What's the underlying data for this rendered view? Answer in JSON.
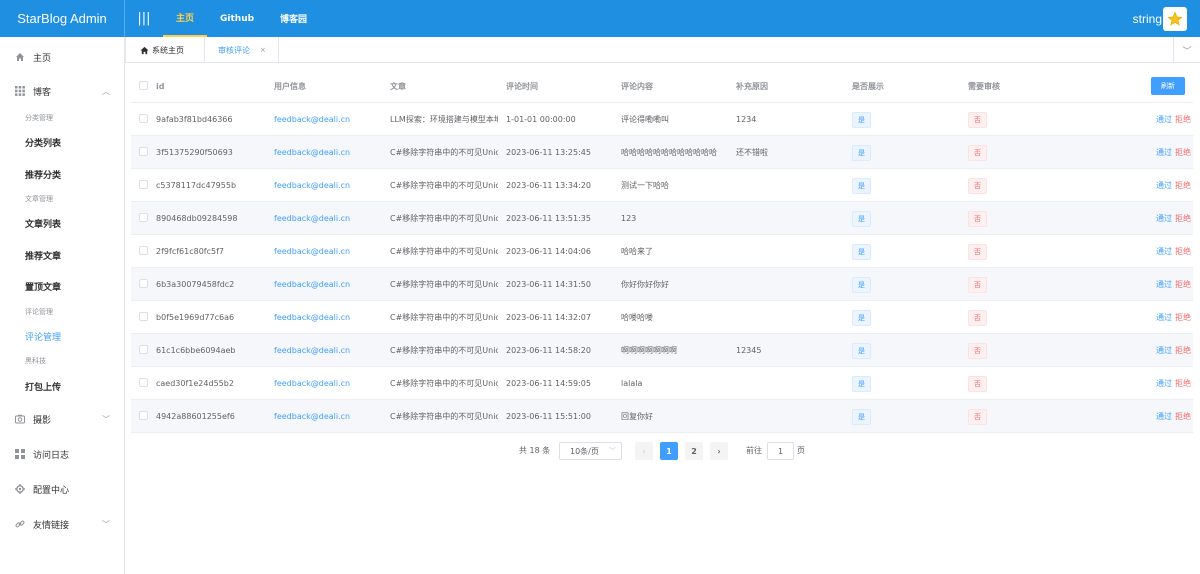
{
  "app": {
    "title": "StarBlog Admin",
    "menu_icon": "hamburger-icon"
  },
  "header": {
    "nav": [
      "主页",
      "Github",
      "博客园"
    ],
    "active_nav": 0,
    "username": "string",
    "avatar_icon": "star-icon"
  },
  "sidebar": {
    "home": "主页",
    "blog": "博客",
    "group_category": "分类管理",
    "category_list": "分类列表",
    "recommend_category": "推荐分类",
    "group_article": "文章管理",
    "article_list": "文章列表",
    "recommend_article": "推荐文章",
    "pinned_article": "置顶文章",
    "group_comment": "评论管理",
    "comment_manage": "评论管理",
    "group_tech": "黑科技",
    "pack_upload": "打包上传",
    "photo": "摄影",
    "visit_log": "访问日志",
    "config_center": "配置中心",
    "friend_links": "友情链接"
  },
  "tabs": {
    "home": "系统主页",
    "review": "审核评论"
  },
  "table": {
    "headers": {
      "id": "id",
      "user": "用户信息",
      "article": "文章",
      "time": "评论时间",
      "content": "评论内容",
      "note": "补充原因",
      "show": "是否展示",
      "need_review": "需要审核"
    },
    "refresh_label": "刷新",
    "pass_label": "通过",
    "reject_label": "拒绝",
    "rows": [
      {
        "id": "9afab3f81bd46366",
        "user": "feedback@deali.cn",
        "article": "LLM探索：环境搭建与模型本地部署",
        "time": "1-01-01 00:00:00",
        "content": "评论得嘞嘞叫",
        "note": "1234",
        "show": "是",
        "need_review": "否"
      },
      {
        "id": "3f51375290f50693",
        "user": "feedback@deali.cn",
        "article": "C#移除字符串中的不可见Unicode字符",
        "time": "2023-06-11 13:25:45",
        "content": "哈哈哈哈哈哈哈哈哈哈哈哈",
        "note": "还不错啦",
        "show": "是",
        "need_review": "否"
      },
      {
        "id": "c5378117dc47955b",
        "user": "feedback@deali.cn",
        "article": "C#移除字符串中的不可见Unicode字符",
        "time": "2023-06-11 13:34:20",
        "content": "测试一下哈哈",
        "note": "",
        "show": "是",
        "need_review": "否"
      },
      {
        "id": "890468db09284598",
        "user": "feedback@deali.cn",
        "article": "C#移除字符串中的不可见Unicode字符",
        "time": "2023-06-11 13:51:35",
        "content": "123",
        "note": "",
        "show": "是",
        "need_review": "否"
      },
      {
        "id": "2f9fcf61c80fc5f7",
        "user": "feedback@deali.cn",
        "article": "C#移除字符串中的不可见Unicode字符",
        "time": "2023-06-11 14:04:06",
        "content": "哈哈来了",
        "note": "",
        "show": "是",
        "need_review": "否"
      },
      {
        "id": "6b3a30079458fdc2",
        "user": "feedback@deali.cn",
        "article": "C#移除字符串中的不可见Unicode字符",
        "time": "2023-06-11 14:31:50",
        "content": "你好你好你好",
        "note": "",
        "show": "是",
        "need_review": "否"
      },
      {
        "id": "b0f5e1969d77c6a6",
        "user": "feedback@deali.cn",
        "article": "C#移除字符串中的不可见Unicode字符",
        "time": "2023-06-11 14:32:07",
        "content": "哈喽哈喽",
        "note": "",
        "show": "是",
        "need_review": "否"
      },
      {
        "id": "61c1c6bbe6094aeb",
        "user": "feedback@deali.cn",
        "article": "C#移除字符串中的不可见Unicode字符",
        "time": "2023-06-11 14:58:20",
        "content": "啊啊啊啊啊啊啊",
        "note": "12345",
        "show": "是",
        "need_review": "否"
      },
      {
        "id": "caed30f1e24d55b2",
        "user": "feedback@deali.cn",
        "article": "C#移除字符串中的不可见Unicode字符",
        "time": "2023-06-11 14:59:05",
        "content": "lalala",
        "note": "",
        "show": "是",
        "need_review": "否"
      },
      {
        "id": "4942a88601255ef6",
        "user": "feedback@deali.cn",
        "article": "C#移除字符串中的不可见Unicode字符",
        "time": "2023-06-11 15:51:00",
        "content": "回复你好",
        "note": "",
        "show": "是",
        "need_review": "否"
      }
    ]
  },
  "pagination": {
    "total": "共 18 条",
    "page_size": "10条/页",
    "pages": [
      "1",
      "2"
    ],
    "current": "1",
    "goto_prefix": "前往",
    "goto_value": "1",
    "goto_suffix": "页"
  },
  "colors": {
    "header": "#1e8fe1",
    "primary": "#409eff",
    "danger": "#f56c6c",
    "active_nav": "#ffd04b"
  }
}
